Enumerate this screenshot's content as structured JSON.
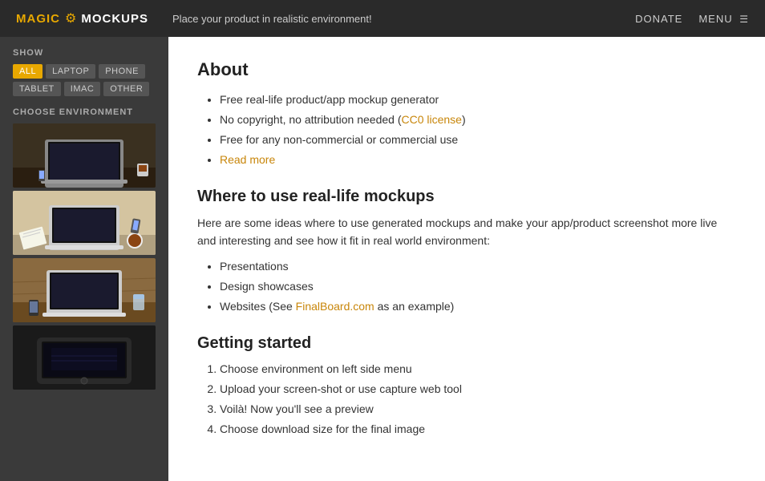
{
  "header": {
    "logo_magic": "MAGIC",
    "logo_mockups": "MOCKUPS",
    "tagline": "Place your product in realistic environment!",
    "donate_label": "DONATE",
    "menu_label": "MENU"
  },
  "sidebar": {
    "show_label": "SHOW",
    "filters": [
      {
        "id": "all",
        "label": "ALL",
        "active": true
      },
      {
        "id": "laptop",
        "label": "LAPTOP",
        "active": false
      },
      {
        "id": "phone",
        "label": "PHONE",
        "active": false
      },
      {
        "id": "tablet",
        "label": "TABLET",
        "active": false
      },
      {
        "id": "imac",
        "label": "IMAC",
        "active": false
      },
      {
        "id": "other",
        "label": "OTHER",
        "active": false
      }
    ],
    "choose_env_label": "CHOOSE ENVIRONMENT",
    "thumbnails": [
      {
        "id": 1,
        "alt": "Laptop on dark desk"
      },
      {
        "id": 2,
        "alt": "Laptop with notebook and coffee"
      },
      {
        "id": 3,
        "alt": "Laptop with phone on wood desk"
      },
      {
        "id": 4,
        "alt": "Dark tablet mockup"
      }
    ]
  },
  "content": {
    "about_heading": "About",
    "about_items": [
      "Free real-life product/app mockup generator",
      "No copyright, no attribution needed (CC0 license)",
      "Free for any non-commercial or commercial use",
      "Read more"
    ],
    "cc0_link_text": "CC0 license",
    "read_more_text": "Read more",
    "where_heading": "Where to use real-life mockups",
    "where_intro": "Here are some ideas where to use generated mockups and make your app/product screenshot more live and interesting and see how it fit in real world environment:",
    "where_items": [
      "Presentations",
      "Design showcases",
      "Websites (See FinalBoard.com as an example)"
    ],
    "finalboard_text": "FinalBoard.com",
    "getting_started_heading": "Getting started",
    "steps": [
      "Choose environment on left side menu",
      "Upload your screen-shot or use capture web tool",
      "Voilà! Now you'll see a preview",
      "Choose download size for the final image"
    ]
  }
}
